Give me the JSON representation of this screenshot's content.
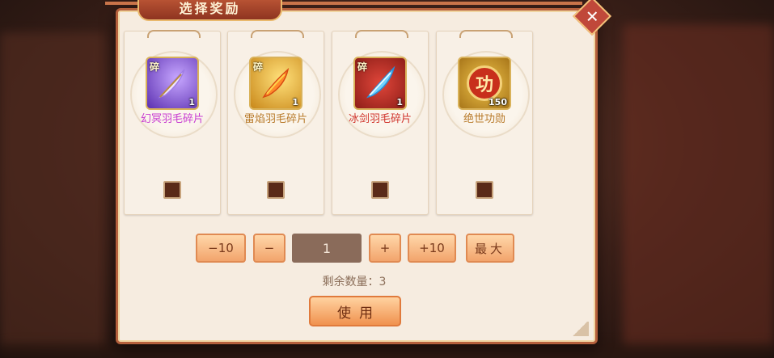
{
  "dialog": {
    "title": "选择奖励",
    "close_icon": "close-icon",
    "close_glyph": "✕"
  },
  "rewards": [
    {
      "name": "幻冥羽毛碎片",
      "fragment_tag": "碎",
      "quantity": "1",
      "name_color": "#c83bd1",
      "icon": "purple-feather-icon",
      "icon_bg": "#8a5ad6"
    },
    {
      "name": "雷焰羽毛碎片",
      "fragment_tag": "碎",
      "quantity": "1",
      "name_color": "#b87a2a",
      "icon": "fire-feather-icon",
      "icon_bg": "#d7a62a"
    },
    {
      "name": "冰剑羽毛碎片",
      "fragment_tag": "碎",
      "quantity": "1",
      "name_color": "#d0342c",
      "icon": "ice-feather-icon",
      "icon_bg": "#b02a24"
    },
    {
      "name": "绝世功勋",
      "fragment_tag": "",
      "quantity": "150",
      "name_color": "#b87a2a",
      "icon": "merit-coin-icon",
      "icon_bg": "#c9961f",
      "coin_char": "功"
    }
  ],
  "quantity_controls": {
    "minus10": "−10",
    "minus1": "−",
    "value": "1",
    "plus1": "+",
    "plus10": "+10",
    "max": "最大"
  },
  "remaining_text": "剩余数量：3",
  "use_button": "使用"
}
